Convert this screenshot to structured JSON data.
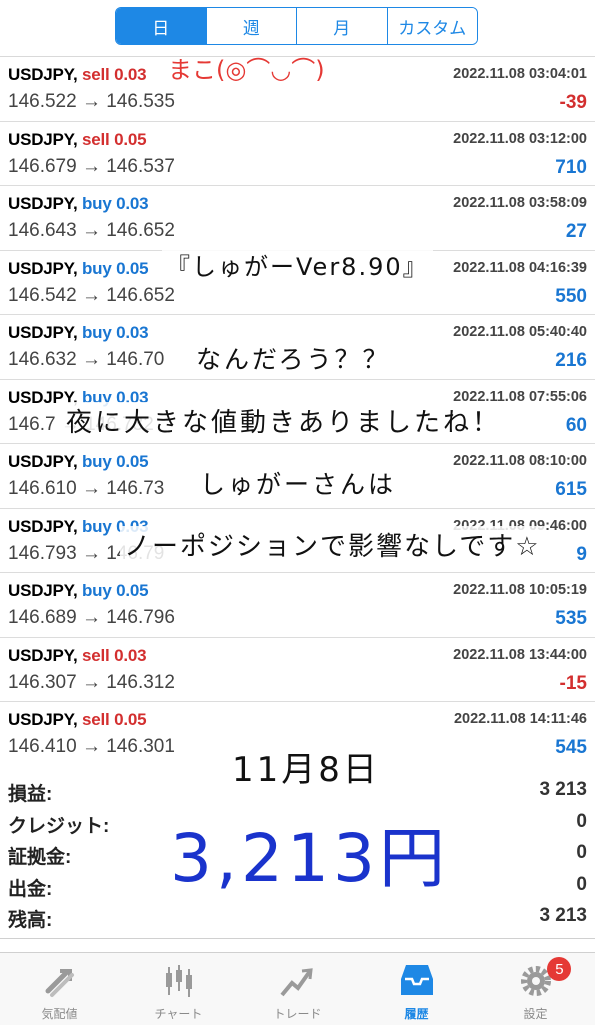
{
  "tabs_top": [
    {
      "label": "日",
      "active": true
    },
    {
      "label": "週",
      "active": false
    },
    {
      "label": "月",
      "active": false
    },
    {
      "label": "カスタム",
      "active": false
    }
  ],
  "trades": [
    {
      "symbol": "USDJPY,",
      "side": "sell",
      "lot": "sell 0.03",
      "time": "2022.11.08 03:04:01",
      "prices": "146.522 → 146.535",
      "profit": "-39"
    },
    {
      "symbol": "USDJPY,",
      "side": "sell",
      "lot": "sell 0.05",
      "time": "2022.11.08 03:12:00",
      "prices": "146.679 → 146.537",
      "profit": "710"
    },
    {
      "symbol": "USDJPY,",
      "side": "buy",
      "lot": "buy 0.03",
      "time": "2022.11.08 03:58:09",
      "prices": "146.643 → 146.652",
      "profit": "27"
    },
    {
      "symbol": "USDJPY,",
      "side": "buy",
      "lot": "buy 0.05",
      "time": "2022.11.08 04:16:39",
      "prices": "146.542 → 146.652",
      "profit": "550"
    },
    {
      "symbol": "USDJPY,",
      "side": "buy",
      "lot": "buy 0.03",
      "time": "2022.11.08 05:40:40",
      "prices": "146.632 → 146.70",
      "profit": "216"
    },
    {
      "symbol": "USDJPY,",
      "side": "buy",
      "lot": "buy 0.03",
      "time": "2022.11.08 07:55:06",
      "prices": "146.7 → 146.732",
      "profit": "60"
    },
    {
      "symbol": "USDJPY,",
      "side": "buy",
      "lot": "buy 0.05",
      "time": "2022.11.08 08:10:00",
      "prices": "146.610 → 146.73",
      "profit": "615"
    },
    {
      "symbol": "USDJPY,",
      "side": "buy",
      "lot": "buy 0.03",
      "time": "2022.11.08 09:46:00",
      "prices": "146.793 → 146.79",
      "profit": "9"
    },
    {
      "symbol": "USDJPY,",
      "side": "buy",
      "lot": "buy 0.05",
      "time": "2022.11.08 10:05:19",
      "prices": "146.689 → 146.796",
      "profit": "535"
    },
    {
      "symbol": "USDJPY,",
      "side": "sell",
      "lot": "sell 0.03",
      "time": "2022.11.08 13:44:00",
      "prices": "146.307 → 146.312",
      "profit": "-15"
    },
    {
      "symbol": "USDJPY,",
      "side": "sell",
      "lot": "sell 0.05",
      "time": "2022.11.08 14:11:46",
      "prices": "146.410 → 146.301",
      "profit": "545"
    }
  ],
  "summary": [
    {
      "label": "損益:",
      "value": "3 213"
    },
    {
      "label": "クレジット:",
      "value": "0"
    },
    {
      "label": "証拠金:",
      "value": "0"
    },
    {
      "label": "出金:",
      "value": "0"
    },
    {
      "label": "残高:",
      "value": "3 213"
    }
  ],
  "tabbar": [
    {
      "label": "気配値",
      "icon": "quotes-icon",
      "active": false
    },
    {
      "label": "チャート",
      "icon": "chart-icon",
      "active": false
    },
    {
      "label": "トレード",
      "icon": "trade-icon",
      "active": false
    },
    {
      "label": "履歴",
      "icon": "history-icon",
      "active": true
    },
    {
      "label": "設定",
      "icon": "settings-icon",
      "active": false,
      "badge": "5"
    }
  ],
  "handwriting": {
    "author": "まこ(◎⌒◡⌒)",
    "line1": "『しゅがーVer8.90』",
    "line2": "なんだろう？？",
    "line3": "夜に大きな値動きありましたね！",
    "line4": "しゅがーさんは",
    "line5": "ノーポジションで影響なしです☆",
    "date": "11月8日",
    "amount": "3,213円"
  },
  "colors": {
    "accent": "#1E88E5",
    "sell": "#D32F2F",
    "buy": "#1976D2",
    "badge": "#E53935",
    "amount_ink": "#1a33cc"
  }
}
